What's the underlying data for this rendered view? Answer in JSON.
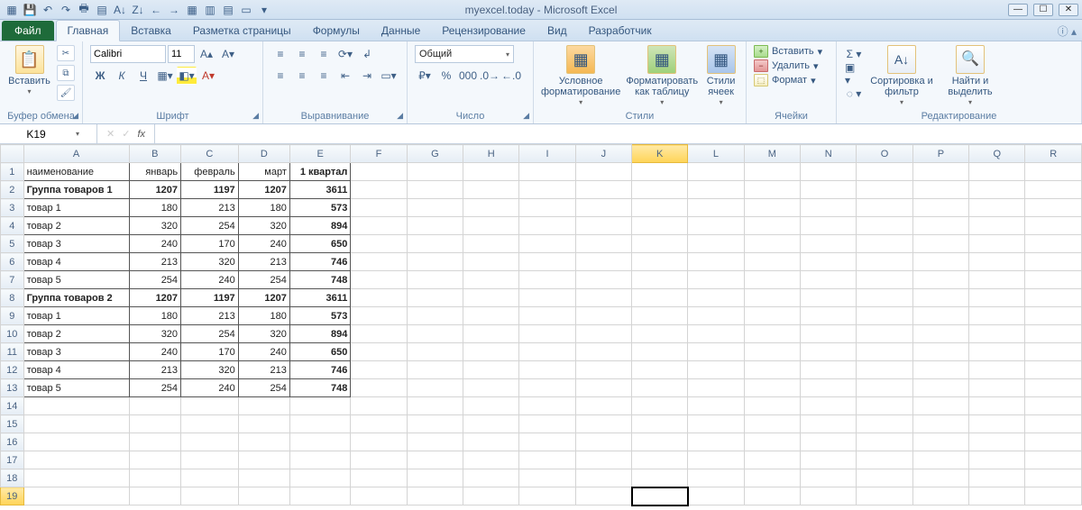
{
  "app": {
    "title": "myexcel.today  -  Microsoft Excel"
  },
  "tabs": {
    "file": "Файл",
    "items": [
      "Главная",
      "Вставка",
      "Разметка страницы",
      "Формулы",
      "Данные",
      "Рецензирование",
      "Вид",
      "Разработчик"
    ],
    "active": 0
  },
  "ribbon": {
    "clipboard": {
      "label": "Буфер обмена",
      "paste": "Вставить"
    },
    "font": {
      "label": "Шрифт",
      "name": "Calibri",
      "size": "11",
      "bold": "Ж",
      "italic": "К",
      "underline": "Ч"
    },
    "alignment": {
      "label": "Выравнивание"
    },
    "number": {
      "label": "Число",
      "format": "Общий"
    },
    "styles": {
      "label": "Стили",
      "conditional": "Условное форматирование",
      "astable": "Форматировать как таблицу",
      "cellstyles": "Стили ячеек"
    },
    "cells": {
      "label": "Ячейки",
      "insert": "Вставить",
      "delete": "Удалить",
      "format": "Формат"
    },
    "editing": {
      "label": "Редактирование",
      "sortfilter": "Сортировка и фильтр",
      "findselect": "Найти и выделить"
    }
  },
  "namebox": "K19",
  "formula": "",
  "columns": [
    "A",
    "B",
    "C",
    "D",
    "E",
    "F",
    "G",
    "H",
    "I",
    "J",
    "K",
    "L",
    "M",
    "N",
    "O",
    "P",
    "Q",
    "R"
  ],
  "selected_col": "K",
  "selected_row": 19,
  "active_cell": {
    "row": 19,
    "col": "K"
  },
  "sheet": {
    "headers": [
      "наименование",
      "январь",
      "февраль",
      "март",
      "1 квартал"
    ],
    "rows": [
      {
        "r": 2,
        "bold": true,
        "cells": [
          "Группа товаров 1",
          "1207",
          "1197",
          "1207",
          "3611"
        ]
      },
      {
        "r": 3,
        "cells": [
          "товар 1",
          "180",
          "213",
          "180",
          "573"
        ]
      },
      {
        "r": 4,
        "cells": [
          "товар 2",
          "320",
          "254",
          "320",
          "894"
        ]
      },
      {
        "r": 5,
        "cells": [
          "товар 3",
          "240",
          "170",
          "240",
          "650"
        ]
      },
      {
        "r": 6,
        "cells": [
          "товар 4",
          "213",
          "320",
          "213",
          "746"
        ]
      },
      {
        "r": 7,
        "cells": [
          "товар 5",
          "254",
          "240",
          "254",
          "748"
        ]
      },
      {
        "r": 8,
        "bold": true,
        "cells": [
          "Группа товаров 2",
          "1207",
          "1197",
          "1207",
          "3611"
        ]
      },
      {
        "r": 9,
        "cells": [
          "товар 1",
          "180",
          "213",
          "180",
          "573"
        ]
      },
      {
        "r": 10,
        "cells": [
          "товар 2",
          "320",
          "254",
          "320",
          "894"
        ]
      },
      {
        "r": 11,
        "cells": [
          "товар 3",
          "240",
          "170",
          "240",
          "650"
        ]
      },
      {
        "r": 12,
        "cells": [
          "товар 4",
          "213",
          "320",
          "213",
          "746"
        ]
      },
      {
        "r": 13,
        "cells": [
          "товар 5",
          "254",
          "240",
          "254",
          "748"
        ]
      }
    ],
    "empty_rows": [
      14,
      15,
      16,
      17,
      18,
      19
    ],
    "last_data_col": "E",
    "bold_last_col": true
  },
  "icons": {
    "qat": [
      "excel",
      "save",
      "undo",
      "redo",
      "print",
      "new",
      "open",
      "sort-asc",
      "sort-desc",
      "l",
      "r",
      "table",
      "cols",
      "doc",
      "more"
    ]
  }
}
